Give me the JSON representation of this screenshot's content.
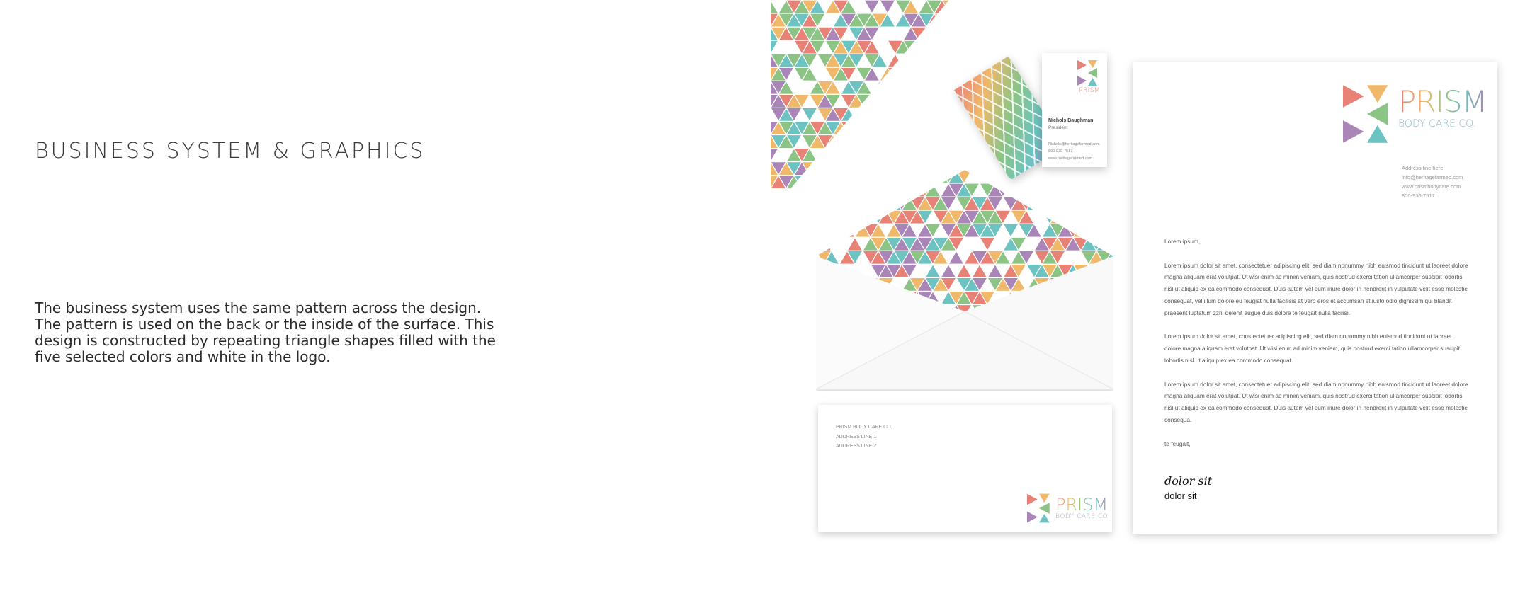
{
  "heading": {
    "title": "BUSINESS SYSTEM & GRAPHICS"
  },
  "description": "The business system uses the same pattern across the design. The pattern is used on the back or the inside of the surface. This design is constructed by repeating triangle shapes filled with the five selected colors and white in the logo.",
  "palette": [
    "#e88277",
    "#f0b86a",
    "#8cc486",
    "#6cc3c1",
    "#a985b8"
  ],
  "brand": {
    "name": "PRISM",
    "tagline": "BODY CARE CO."
  },
  "business_card": {
    "brand": "PRISM",
    "name": "Nichols Baughman",
    "role": "President",
    "email": "Nichols@heritagefarmed.com",
    "phone": "800-930-7517",
    "website": "www.heritagefarmed.com"
  },
  "envelope": {
    "return_line1": "PRISM BODY CARE CO.",
    "return_line2": "ADDRESS LINE 1",
    "return_line3": "ADDRESS LINE 2"
  },
  "letterhead": {
    "contact": {
      "address": "Address line here",
      "email": "info@heritagefarmed.com",
      "website": "www.prismbodycare.com",
      "phone": "800-930-7517"
    },
    "greeting": "Lorem ipsum,",
    "paragraph1": "Lorem ipsum dolor sit amet, consectetuer adipiscing elit, sed diam nonummy nibh euismod tincidunt ut laoreet dolore magna aliquam erat volutpat. Ut wisi enim ad minim veniam, quis nostrud exerci tation ullamcorper suscipit lobortis nisl ut aliquip ex ea commodo consequat. Duis autem vel eum iriure dolor in hendrerit in vulputate velit esse molestie consequat, vel illum dolore eu feugiat nulla facilisis at vero eros et accumsan et iusto odio dignissim qui blandit praesent luptatum zzril delenit augue duis dolore te feugait nulla facilisi.",
    "paragraph2": "Lorem ipsum dolor sit amet, cons ectetuer adipiscing elit, sed diam nonummy nibh euismod tincidunt ut laoreet dolore magna aliquam erat volutpat. Ut wisi enim ad minim veniam, quis nostrud exerci tation ullamcorper suscipit lobortis nisl ut aliquip ex ea commodo consequat.",
    "paragraph3": "Lorem ipsum dolor sit amet, consectetuer adipiscing elit, sed diam nonummy nibh euismod tincidunt ut laoreet dolore magna aliquam erat volutpat. Ut wisi enim ad minim veniam, quis nostrud exerci tation ullamcorper suscipit lobortis nisl ut aliquip ex ea commodo consequat. Duis autem vel eum iriure dolor in hendrerit in vulputate velit esse molestie consequa.",
    "closing": "te feugait,",
    "signature_script": "dolor sit",
    "signature_name": "dolor sit"
  }
}
